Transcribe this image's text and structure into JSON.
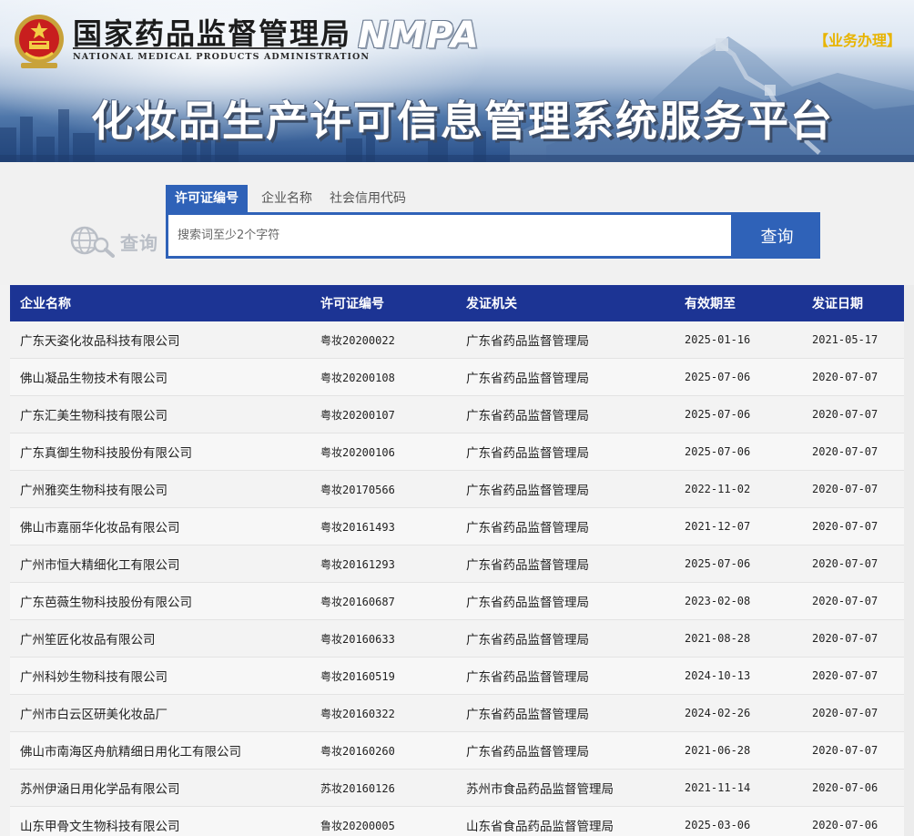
{
  "header": {
    "org_name_cn": "国家药品监督管理局",
    "org_name_en": "NATIONAL MEDICAL PRODUCTS ADMINISTRATION",
    "org_abbr": "NMPA",
    "business_link": "【业务办理】",
    "platform_title": "化妆品生产许可信息管理系统服务平台",
    "colors": {
      "banner_dark": "#284f8a",
      "link_yellow": "#e8b400"
    }
  },
  "search": {
    "deco_label": "查询",
    "tabs": [
      {
        "label": "许可证编号",
        "active": true
      },
      {
        "label": "企业名称",
        "active": false
      },
      {
        "label": "社会信用代码",
        "active": false
      }
    ],
    "input_value": "",
    "placeholder": "搜索词至少2个字符",
    "button_label": "查询",
    "colors": {
      "accent_blue": "#2f62b8"
    }
  },
  "table": {
    "headers": [
      "企业名称",
      "许可证编号",
      "发证机关",
      "有效期至",
      "发证日期"
    ],
    "header_color": "#1c3494",
    "rows": [
      [
        "广东天姿化妆品科技有限公司",
        "粤妆20200022",
        "广东省药品监督管理局",
        "2025-01-16",
        "2021-05-17"
      ],
      [
        "佛山凝品生物技术有限公司",
        "粤妆20200108",
        "广东省药品监督管理局",
        "2025-07-06",
        "2020-07-07"
      ],
      [
        "广东汇美生物科技有限公司",
        "粤妆20200107",
        "广东省药品监督管理局",
        "2025-07-06",
        "2020-07-07"
      ],
      [
        "广东真御生物科技股份有限公司",
        "粤妆20200106",
        "广东省药品监督管理局",
        "2025-07-06",
        "2020-07-07"
      ],
      [
        "广州雅奕生物科技有限公司",
        "粤妆20170566",
        "广东省药品监督管理局",
        "2022-11-02",
        "2020-07-07"
      ],
      [
        "佛山市嘉丽华化妆品有限公司",
        "粤妆20161493",
        "广东省药品监督管理局",
        "2021-12-07",
        "2020-07-07"
      ],
      [
        "广州市恒大精细化工有限公司",
        "粤妆20161293",
        "广东省药品监督管理局",
        "2025-07-06",
        "2020-07-07"
      ],
      [
        "广东芭薇生物科技股份有限公司",
        "粤妆20160687",
        "广东省药品监督管理局",
        "2023-02-08",
        "2020-07-07"
      ],
      [
        "广州笙匠化妆品有限公司",
        "粤妆20160633",
        "广东省药品监督管理局",
        "2021-08-28",
        "2020-07-07"
      ],
      [
        "广州科妙生物科技有限公司",
        "粤妆20160519",
        "广东省药品监督管理局",
        "2024-10-13",
        "2020-07-07"
      ],
      [
        "广州市白云区研美化妆品厂",
        "粤妆20160322",
        "广东省药品监督管理局",
        "2024-02-26",
        "2020-07-07"
      ],
      [
        "佛山市南海区舟航精细日用化工有限公司",
        "粤妆20160260",
        "广东省药品监督管理局",
        "2021-06-28",
        "2020-07-07"
      ],
      [
        "苏州伊涵日用化学品有限公司",
        "苏妆20160126",
        "苏州市食品药品监督管理局",
        "2021-11-14",
        "2020-07-06"
      ],
      [
        "山东甲骨文生物科技有限公司",
        "鲁妆20200005",
        "山东省食品药品监督管理局",
        "2025-03-06",
        "2020-07-06"
      ]
    ]
  }
}
